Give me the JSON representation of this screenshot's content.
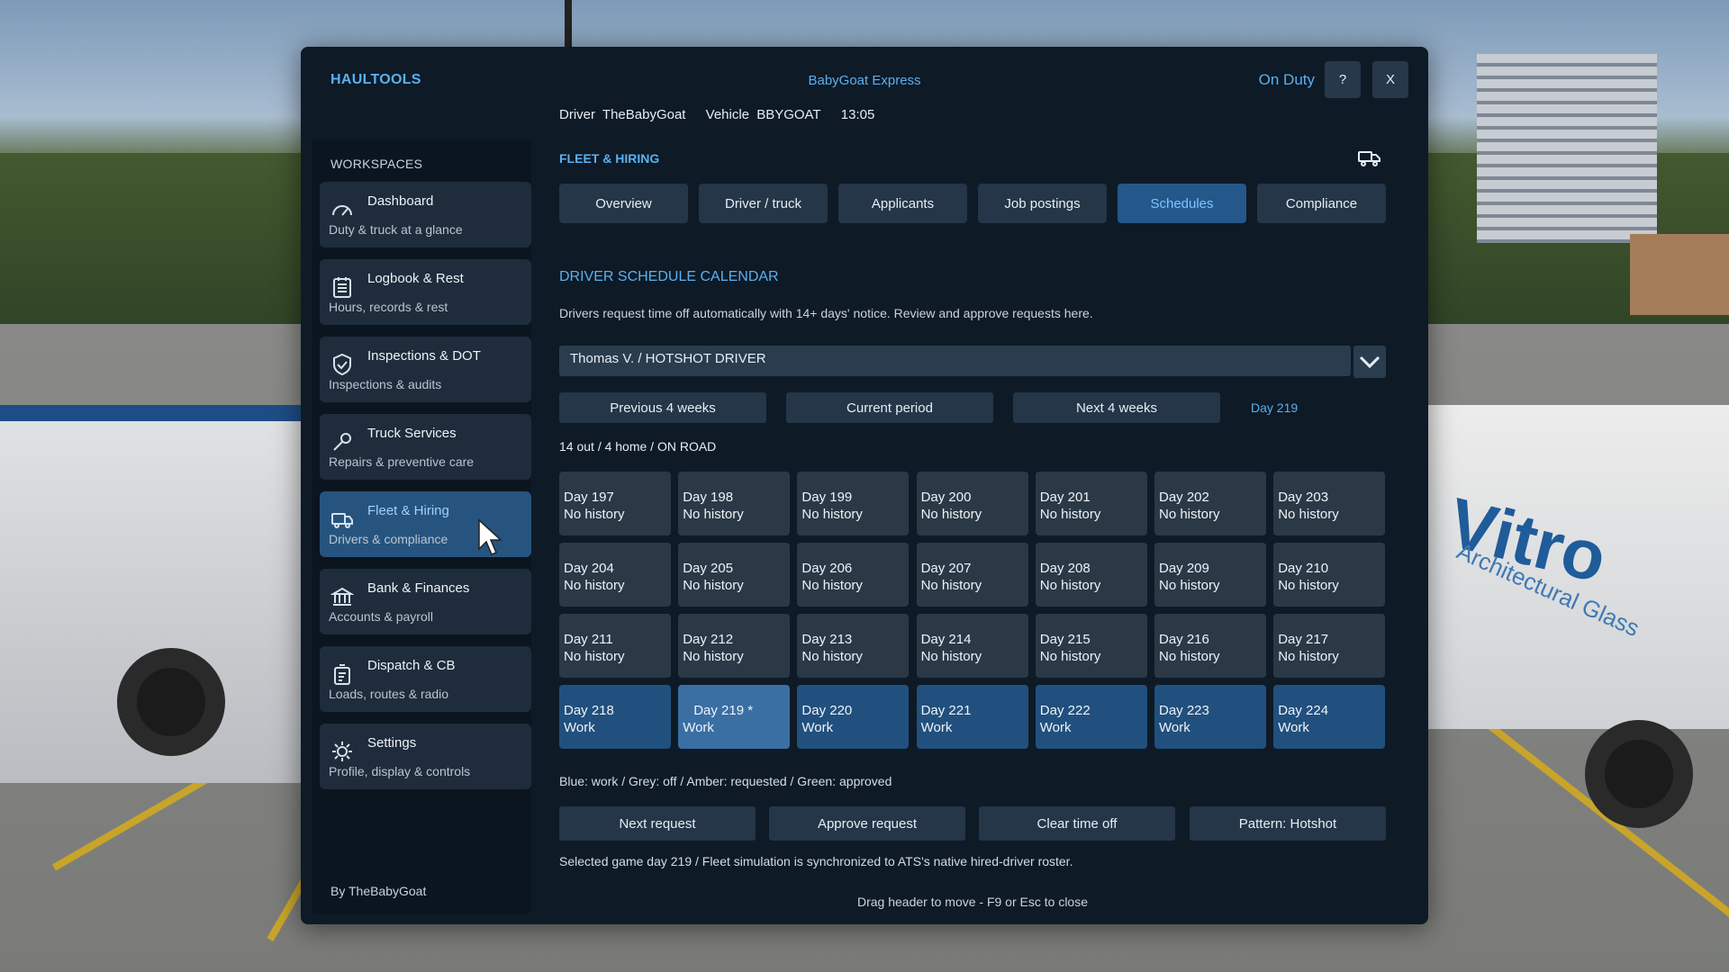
{
  "app": {
    "title": "HAULTOOLS",
    "company": "BabyGoat Express",
    "duty_status": "On Duty",
    "help_label": "?",
    "close_label": "X"
  },
  "info": {
    "driver_label": "Driver",
    "driver_name": "TheBabyGoat",
    "vehicle_label": "Vehicle",
    "vehicle_id": "BBYGOAT",
    "time": "13:05"
  },
  "sidebar": {
    "title": "WORKSPACES",
    "items": [
      {
        "label": "Dashboard",
        "sub": "Duty & truck at a glance",
        "icon": "gauge-icon"
      },
      {
        "label": "Logbook & Rest",
        "sub": "Hours, records & rest",
        "icon": "logbook-icon"
      },
      {
        "label": "Inspections & DOT",
        "sub": "Inspections & audits",
        "icon": "shield-check-icon"
      },
      {
        "label": "Truck Services",
        "sub": "Repairs & preventive care",
        "icon": "wrench-icon"
      },
      {
        "label": "Fleet & Hiring",
        "sub": "Drivers & compliance",
        "icon": "truck-icon",
        "active": true
      },
      {
        "label": "Bank & Finances",
        "sub": "Accounts & payroll",
        "icon": "bank-icon"
      },
      {
        "label": "Dispatch & CB",
        "sub": "Loads, routes & radio",
        "icon": "dispatch-icon"
      },
      {
        "label": "Settings",
        "sub": "Profile, display & controls",
        "icon": "gear-icon"
      }
    ],
    "footer": "By TheBabyGoat"
  },
  "main": {
    "section": "FLEET & HIRING",
    "tabs": [
      {
        "label": "Overview"
      },
      {
        "label": "Driver / truck"
      },
      {
        "label": "Applicants"
      },
      {
        "label": "Job postings"
      },
      {
        "label": "Schedules",
        "active": true
      },
      {
        "label": "Compliance"
      }
    ],
    "calendar_title": "DRIVER SCHEDULE CALENDAR",
    "calendar_desc": "Drivers request time off automatically with 14+ days' notice. Review and approve requests here.",
    "driver_select": "Thomas V. / HOTSHOT DRIVER",
    "period_buttons": [
      "Previous 4 weeks",
      "Current period",
      "Next 4 weeks"
    ],
    "current_day": "Day 219",
    "status": "14 out / 4 home / ON ROAD",
    "days": [
      {
        "day": "Day 197",
        "state": "No history"
      },
      {
        "day": "Day 198",
        "state": "No history"
      },
      {
        "day": "Day 199",
        "state": "No history"
      },
      {
        "day": "Day 200",
        "state": "No history"
      },
      {
        "day": "Day 201",
        "state": "No history"
      },
      {
        "day": "Day 202",
        "state": "No history"
      },
      {
        "day": "Day 203",
        "state": "No history"
      },
      {
        "day": "Day 204",
        "state": "No history"
      },
      {
        "day": "Day 205",
        "state": "No history"
      },
      {
        "day": "Day 206",
        "state": "No history"
      },
      {
        "day": "Day 207",
        "state": "No history"
      },
      {
        "day": "Day 208",
        "state": "No history"
      },
      {
        "day": "Day 209",
        "state": "No history"
      },
      {
        "day": "Day 210",
        "state": "No history"
      },
      {
        "day": "Day 211",
        "state": "No history"
      },
      {
        "day": "Day 212",
        "state": "No history"
      },
      {
        "day": "Day 213",
        "state": "No history"
      },
      {
        "day": "Day 214",
        "state": "No history"
      },
      {
        "day": "Day 215",
        "state": "No history"
      },
      {
        "day": "Day 216",
        "state": "No history"
      },
      {
        "day": "Day 217",
        "state": "No history"
      },
      {
        "day": "Day 218",
        "state": "Work"
      },
      {
        "day": "Day 219 *",
        "state": "Work",
        "selected": true
      },
      {
        "day": "Day 220",
        "state": "Work"
      },
      {
        "day": "Day 221",
        "state": "Work"
      },
      {
        "day": "Day 222",
        "state": "Work"
      },
      {
        "day": "Day 223",
        "state": "Work"
      },
      {
        "day": "Day 224",
        "state": "Work"
      }
    ],
    "legend": "Blue: work  /  Grey: off  /  Amber: requested  /  Green: approved",
    "actions": [
      "Next request",
      "Approve request",
      "Clear time off",
      "Pattern: Hotshot"
    ],
    "footer_note": "Selected game day 219 / Fleet simulation is synchronized to ATS's native hired-driver roster.",
    "footer_hint": "Drag header to move - F9 or Esc to close"
  },
  "colors": {
    "accent": "#5ab0f0",
    "panel": "#0e1a26",
    "work": "#21507e",
    "off": "#2b3947",
    "active_nav": "#26547f"
  }
}
